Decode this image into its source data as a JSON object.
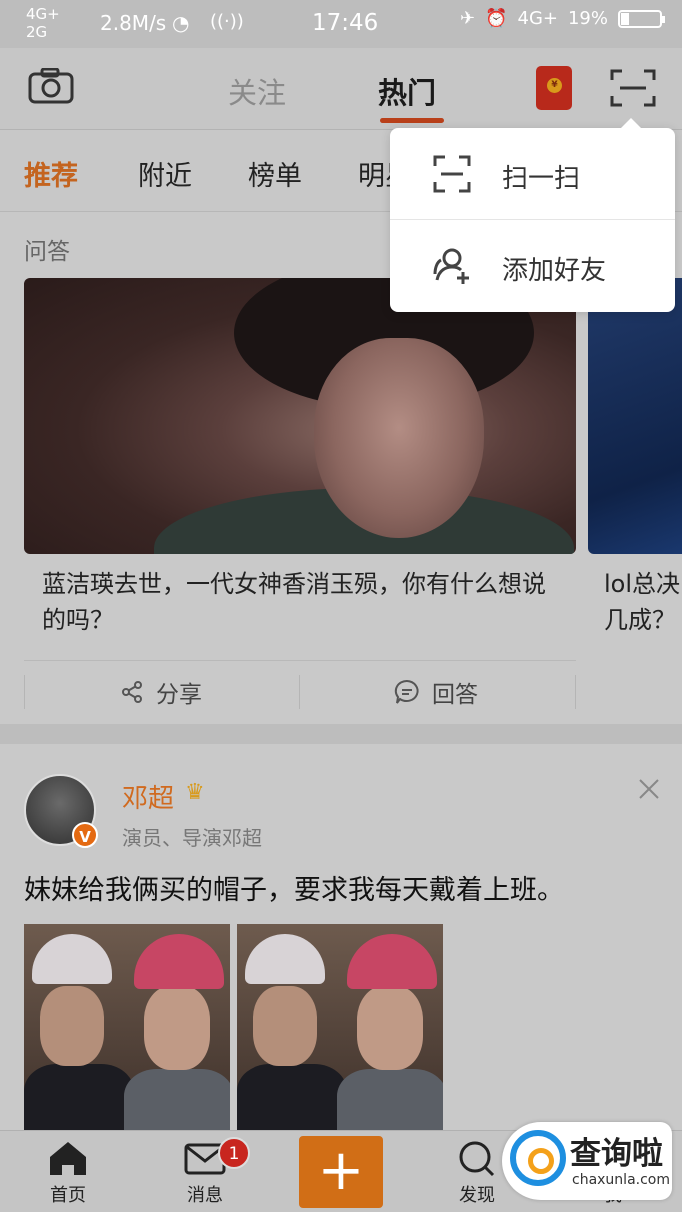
{
  "status_bar": {
    "signal_top": "4G+",
    "signal_bottom": "2G",
    "speed": "2.8M/s",
    "time": "17:46",
    "network_right": "4G+",
    "battery_percent": "19%",
    "battery_level": 0.19
  },
  "top_nav": {
    "tabs": [
      {
        "label": "关注",
        "active": false
      },
      {
        "label": "热门",
        "active": true
      }
    ],
    "red_packet_coin": "¥"
  },
  "sub_tabs": [
    {
      "label": "推荐",
      "active": true
    },
    {
      "label": "附近",
      "active": false
    },
    {
      "label": "榜单",
      "active": false
    },
    {
      "label": "明星",
      "active": false
    }
  ],
  "feed": {
    "section_label": "问答",
    "card_title": "蓝洁瑛去世，一代女神香消玉殒，你有什么想说的吗？",
    "card2_title": "lol总决\n几成？",
    "actions": {
      "share": "分享",
      "reply": "回答"
    },
    "post": {
      "username": "邓超",
      "bio": "演员、导演邓超",
      "verified_badge": "V",
      "text": "妹妹给我俩买的帽子，要求我每天戴着上班。"
    }
  },
  "dropdown_menu": {
    "items": [
      {
        "label": "扫一扫",
        "icon": "scan-icon"
      },
      {
        "label": "添加好友",
        "icon": "add-friend-icon"
      }
    ]
  },
  "bottom_bar": {
    "items": [
      {
        "label": "首页",
        "icon": "home-icon"
      },
      {
        "label": "消息",
        "icon": "mail-icon",
        "badge": "1"
      },
      {
        "label": "",
        "icon": "plus-icon"
      },
      {
        "label": "发现",
        "icon": "search-icon"
      },
      {
        "label": "我",
        "icon": "profile-icon"
      }
    ]
  },
  "watermark": {
    "title": "查询啦",
    "domain": "chaxunla.com"
  },
  "colors": {
    "accent_orange": "#d16e16",
    "active_underline": "#b9401a",
    "badge_red": "#c8261f"
  }
}
